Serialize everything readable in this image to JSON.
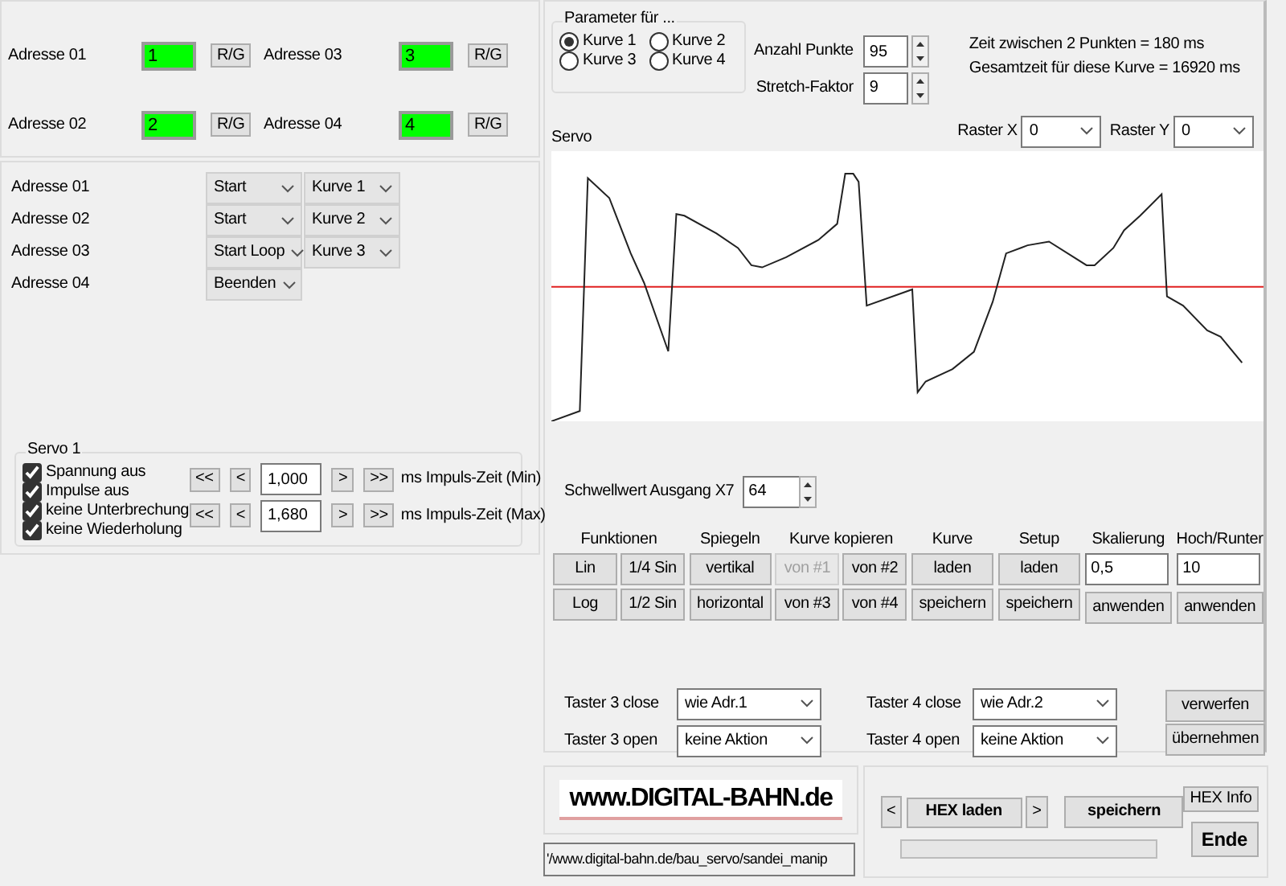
{
  "address_displays": [
    {
      "label": "Adresse 01",
      "value": "1",
      "button": "R/G"
    },
    {
      "label": "Adresse 03",
      "value": "3",
      "button": "R/G"
    },
    {
      "label": "Adresse 02",
      "value": "2",
      "button": "R/G"
    },
    {
      "label": "Adresse 04",
      "value": "4",
      "button": "R/G"
    }
  ],
  "address_actions": [
    {
      "label": "Adresse 01",
      "action": "Start",
      "curve": "Kurve 1"
    },
    {
      "label": "Adresse 02",
      "action": "Start",
      "curve": "Kurve 2"
    },
    {
      "label": "Adresse 03",
      "action": "Start Loop",
      "curve": "Kurve 3"
    },
    {
      "label": "Adresse 04",
      "action": "Beenden"
    }
  ],
  "servo_group": {
    "title": "Servo 1",
    "options": [
      {
        "label": "Spannung aus",
        "checked": true
      },
      {
        "label": "Impulse aus",
        "checked": true
      },
      {
        "label": "keine Unterbrechung",
        "checked": true
      },
      {
        "label": "keine Wiederholung",
        "checked": true
      }
    ],
    "pulse_rows": [
      {
        "before": [
          "<<",
          "<"
        ],
        "value": "1,000",
        "after": [
          ">",
          ">>"
        ],
        "label": "ms Impuls-Zeit (Min)"
      },
      {
        "before": [
          "<<",
          "<"
        ],
        "value": "1,680",
        "after": [
          ">",
          ">>"
        ],
        "label": "ms Impuls-Zeit (Max)"
      }
    ]
  },
  "parameter_group": {
    "title": "Parameter für ...",
    "curves": [
      {
        "label": "Kurve 1",
        "selected": true
      },
      {
        "label": "Kurve 2",
        "selected": false
      },
      {
        "label": "Kurve 3",
        "selected": false
      },
      {
        "label": "Kurve 4",
        "selected": false
      }
    ]
  },
  "spin_fields": [
    {
      "label": "Anzahl Punkte",
      "value": "95"
    },
    {
      "label": "Stretch-Faktor",
      "value": "9"
    }
  ],
  "info_lines": [
    "Zeit zwischen 2 Punkten = 180 ms",
    "Gesamtzeit für diese Kurve = 16920 ms"
  ],
  "raster": [
    {
      "label": "Raster X",
      "value": "0"
    },
    {
      "label": "Raster Y",
      "value": "0"
    }
  ],
  "graph": {
    "title": "Servo"
  },
  "threshold": {
    "label": "Schwellwert Ausgang X7",
    "value": "64"
  },
  "tool_groups": [
    {
      "title": "Funktionen",
      "items": [
        {
          "kind": "button",
          "label": "Lin",
          "disabled": false
        },
        {
          "kind": "button",
          "label": "1/4 Sin",
          "disabled": false
        },
        {
          "kind": "button",
          "label": "Log",
          "disabled": false
        },
        {
          "kind": "button",
          "label": "1/2 Sin",
          "disabled": false
        }
      ]
    },
    {
      "title": "Spiegeln",
      "items": [
        {
          "kind": "button",
          "label": "vertikal",
          "disabled": false
        },
        {
          "kind": "button",
          "label": "horizontal",
          "disabled": false
        }
      ]
    },
    {
      "title": "Kurve kopieren",
      "items": [
        {
          "kind": "button",
          "label": "von #1",
          "disabled": true
        },
        {
          "kind": "button",
          "label": "von #2",
          "disabled": false
        },
        {
          "kind": "button",
          "label": "von #3",
          "disabled": false
        },
        {
          "kind": "button",
          "label": "von #4",
          "disabled": false
        }
      ]
    },
    {
      "title": "Kurve",
      "items": [
        {
          "kind": "button",
          "label": "laden",
          "disabled": false
        },
        {
          "kind": "button",
          "label": "speichern",
          "disabled": false
        }
      ]
    },
    {
      "title": "Setup",
      "items": [
        {
          "kind": "button",
          "label": "laden",
          "disabled": false
        },
        {
          "kind": "button",
          "label": "speichern",
          "disabled": false
        }
      ]
    },
    {
      "title": "Skalierung",
      "items": [
        {
          "kind": "field",
          "value": "0,5"
        },
        {
          "kind": "button",
          "label": "anwenden",
          "disabled": false
        }
      ]
    },
    {
      "title": "Hoch/Runter",
      "items": [
        {
          "kind": "field",
          "value": "10"
        },
        {
          "kind": "button",
          "label": "anwenden",
          "disabled": false
        }
      ]
    }
  ],
  "taster": [
    {
      "label": "Taster 3 close",
      "value": "wie Adr.1"
    },
    {
      "label": "Taster 4 close",
      "value": "wie Adr.2"
    },
    {
      "label": "Taster 3 open",
      "value": "keine Aktion"
    },
    {
      "label": "Taster 4 open",
      "value": "keine Aktion"
    }
  ],
  "edit_buttons": [
    "verwerfen",
    "übernehmen"
  ],
  "logo": "www.DIGITAL-BAHN.de",
  "url": "'/www.digital-bahn.de/bau_servo/sandei_manip",
  "hex_panel": {
    "prev": "<",
    "load": "HEX laden",
    "next": ">",
    "save": "speichern",
    "info": "HEX Info",
    "exit": "Ende",
    "progress": {
      "level": 0
    }
  }
}
